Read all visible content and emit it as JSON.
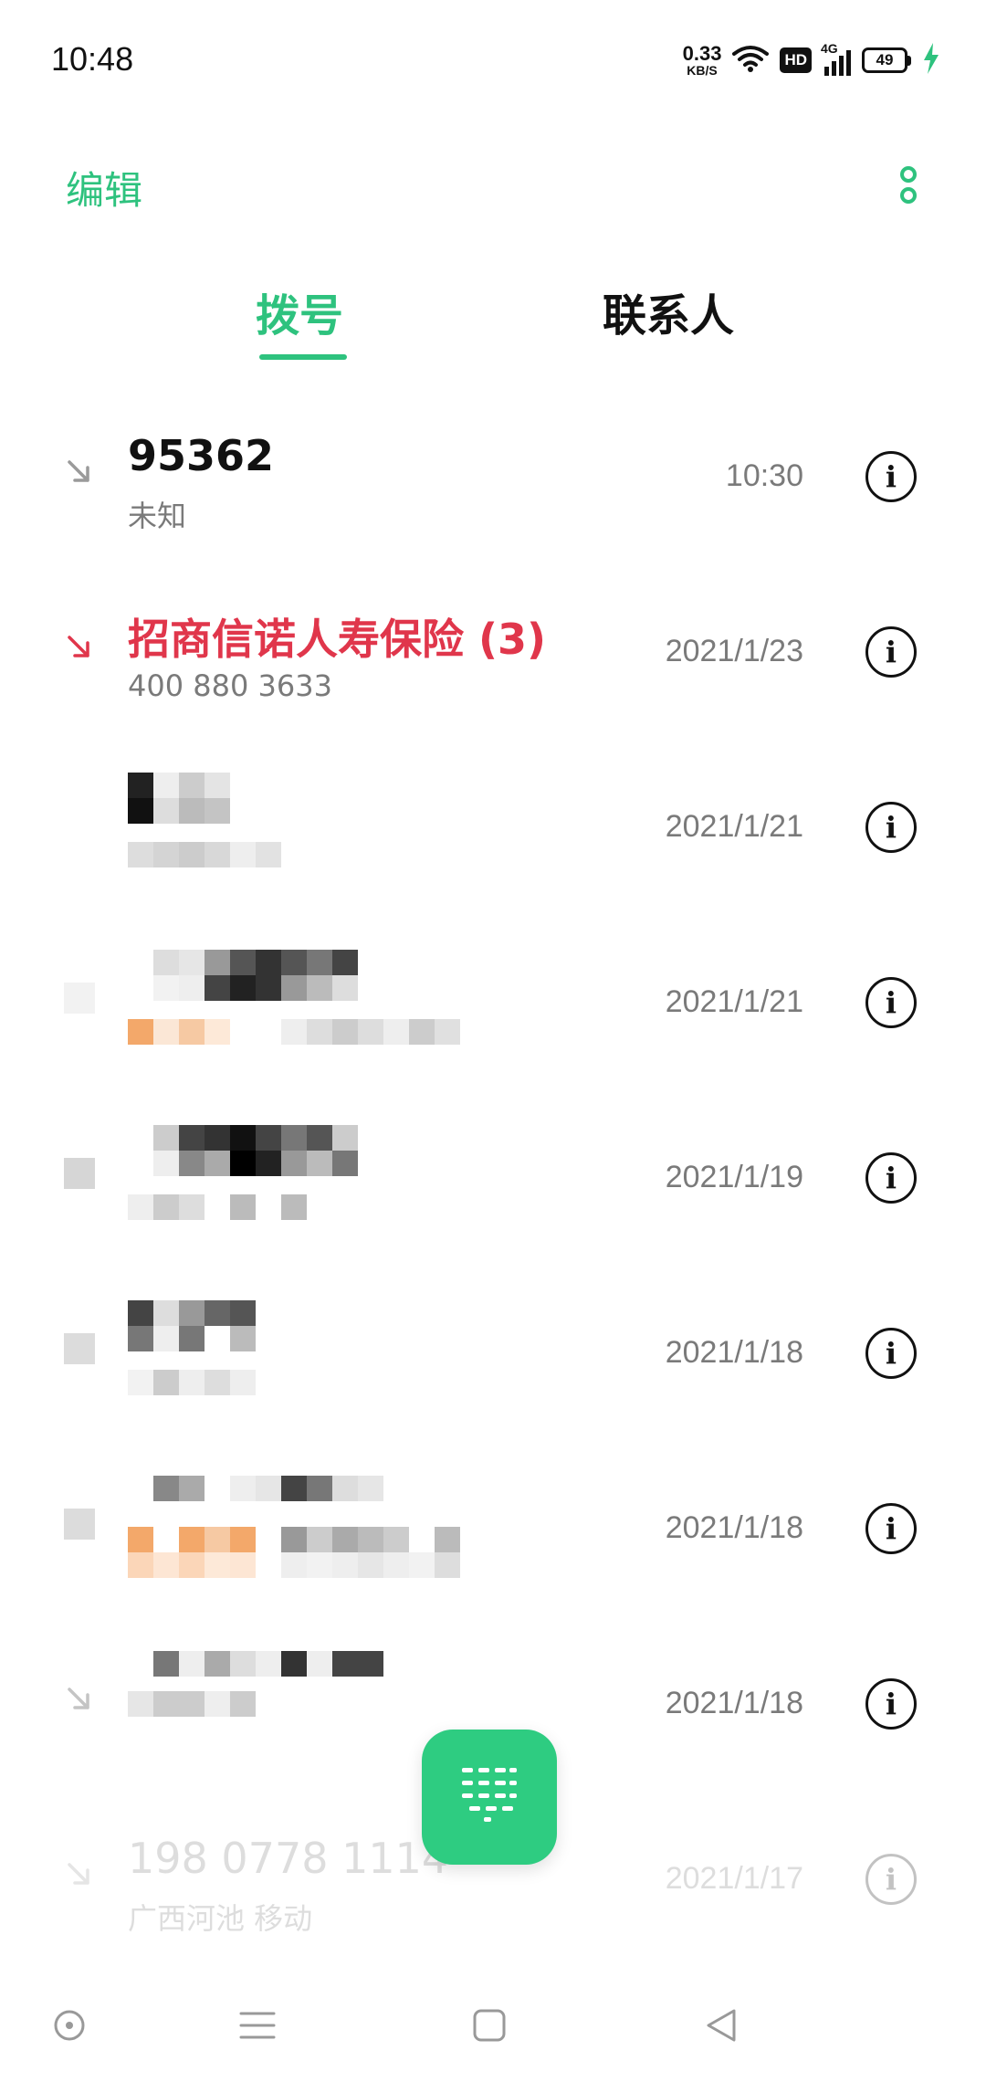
{
  "status_bar": {
    "time": "10:48",
    "net_speed_value": "0.33",
    "net_speed_unit": "KB/S",
    "hd_label": "HD",
    "network_type": "4G",
    "battery_level": "49"
  },
  "header": {
    "edit_label": "编辑",
    "more_icon": "more-vertical-icon"
  },
  "tabs": [
    {
      "label": "拨号",
      "active": true
    },
    {
      "label": "联系人",
      "active": false
    }
  ],
  "calls": [
    {
      "name": "95362",
      "sub": "未知",
      "time": "10:30",
      "type": "incoming"
    },
    {
      "name": "招商信诺人寿保险 (3)",
      "sub": "400 880 3633",
      "time": "2021/1/23",
      "type": "missed"
    },
    {
      "name": "",
      "sub": "",
      "time": "2021/1/21",
      "type": "redacted"
    },
    {
      "name": "",
      "sub": "",
      "time": "2021/1/21",
      "type": "redacted"
    },
    {
      "name": "",
      "sub": "",
      "time": "2021/1/19",
      "type": "redacted"
    },
    {
      "name": "",
      "sub": "",
      "time": "2021/1/18",
      "type": "redacted"
    },
    {
      "name": "",
      "sub": "",
      "time": "2021/1/18",
      "type": "redacted"
    },
    {
      "name": "",
      "sub": "",
      "time": "2021/1/18",
      "type": "redacted"
    },
    {
      "name": "198 0778 1114",
      "sub": "广西河池 移动",
      "time": "2021/1/17",
      "type": "incoming"
    }
  ],
  "colors": {
    "accent": "#2ec27e",
    "missed": "#e0364b",
    "secondary_text": "#7a7a7a"
  },
  "fab_icon": "dialpad-icon",
  "nav_icons": [
    "assistant-icon",
    "menu-icon",
    "home-icon",
    "back-icon"
  ]
}
